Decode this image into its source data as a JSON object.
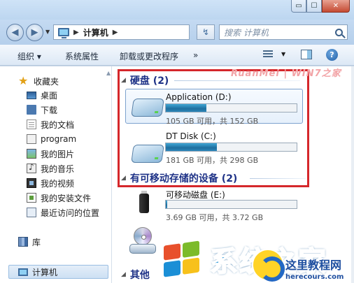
{
  "window": {
    "min_label": "▭",
    "max_label": "☐",
    "close_label": "✕"
  },
  "nav": {
    "back_glyph": "◀",
    "forward_glyph": "▶",
    "dropdown_glyph": "▼"
  },
  "address": {
    "separator": "▶",
    "location": "计算机",
    "trail_separator": "▶",
    "refresh_glyph": "↯"
  },
  "search": {
    "placeholder": "搜索 计算机"
  },
  "toolbar": {
    "organize": "组织 ▾",
    "system_properties": "系统属性",
    "uninstall": "卸载或更改程序",
    "more": "»",
    "view_drop": "▼",
    "help": "?"
  },
  "sidebar": {
    "favorites_label": "收藏夹",
    "items": [
      {
        "label": "桌面"
      },
      {
        "label": "下载"
      },
      {
        "label": "我的文档"
      },
      {
        "label": "program"
      },
      {
        "label": "我的图片"
      },
      {
        "label": "我的音乐"
      },
      {
        "label": "我的视频"
      },
      {
        "label": "我的安装文件"
      },
      {
        "label": "最近访问的位置"
      }
    ],
    "library_label": "库",
    "computer_label": "计算机",
    "pin_glyph": "▲"
  },
  "main": {
    "hard_disks": {
      "heading": "硬盘 (2)",
      "tri": "◢"
    },
    "drives": [
      {
        "name": "Application (D:)",
        "free_text": "105 GB 可用，共 152 GB",
        "used_fraction": 0.31
      },
      {
        "name": "DT Disk (C:)",
        "free_text": "181 GB 可用，共 298 GB",
        "used_fraction": 0.39
      }
    ],
    "removable": {
      "heading": "有可移动存储的设备 (2)",
      "tri": "◢"
    },
    "removable_drives": [
      {
        "name": "可移动磁盘 (E:)",
        "free_text": "3.69 GB 可用，共 3.72 GB",
        "used_fraction": 0.01
      }
    ],
    "other": {
      "heading": "其他",
      "tri": "◢"
    }
  },
  "watermarks": {
    "top": "RuanMei | WIN7之家",
    "big_text": "系统之家",
    "brand_cn": "这里教程网",
    "brand_en": "herecours.com"
  },
  "colors": {
    "annotation": "#d5272b",
    "group_heading": "#1e3287",
    "bar_fill": "#2d88bb"
  }
}
